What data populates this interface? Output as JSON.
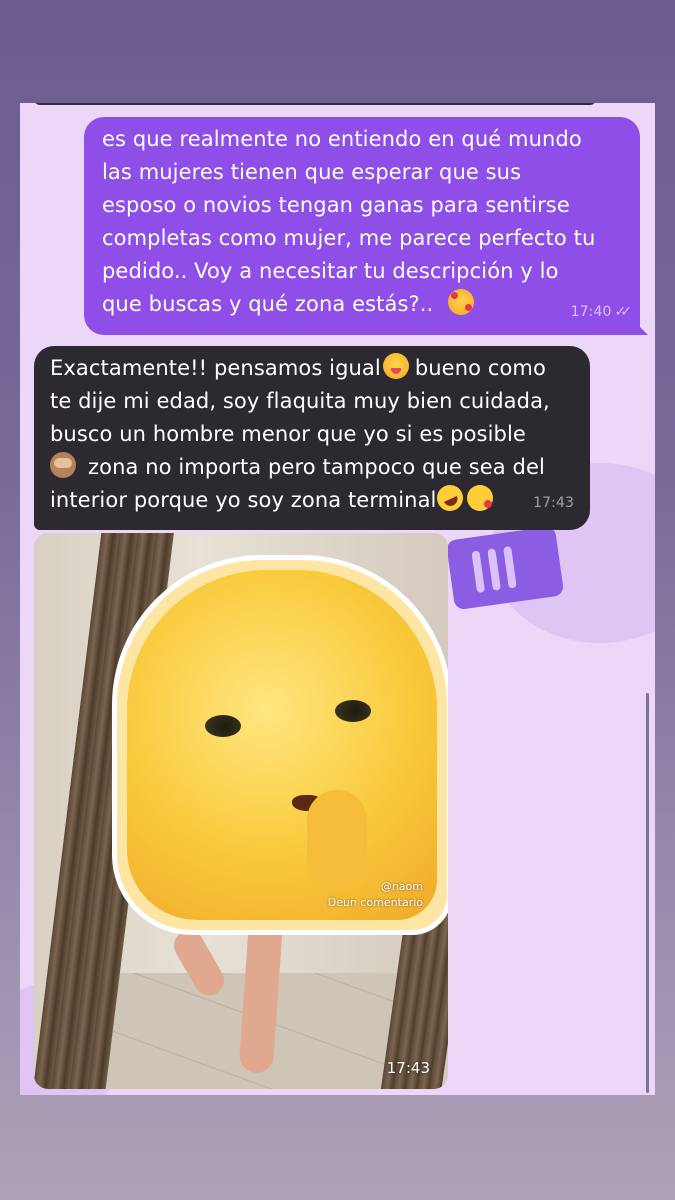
{
  "theme": {
    "outgoing_color": "#8e4ee7",
    "incoming_color": "#2c2930",
    "chat_background": "#ecd7f8"
  },
  "messages": [
    {
      "direction": "outgoing",
      "lines": [
        "es que realmente no entiendo en qué mundo",
        "las mujeres tienen que esperar que sus",
        "esposo o novios tengan ganas para sentirse",
        "completas como mujer, me parece perfecto tu",
        "pedido.. Voy a necesitar tu descripción y lo",
        "que buscas y qué zona estás?.."
      ],
      "emoji": "smiling-face-with-hearts",
      "time": "17:40",
      "status": "read-double-check"
    },
    {
      "direction": "incoming",
      "lines": [
        "Exactamente!! pensamos igual",
        "bueno como",
        "te dije mi edad, soy flaquita muy bien cuidada,",
        "busco un hombre menor que yo si es posible",
        "zona no importa pero tampoco que sea del",
        "interior porque yo soy zona terminal"
      ],
      "emojis": [
        "face-savoring-food",
        "see-no-evil-monkey",
        "rolling-on-floor-laughing",
        "face-blowing-kiss"
      ],
      "time": "17:43"
    },
    {
      "direction": "incoming",
      "type": "photo",
      "sticker_credit": [
        "@naom",
        "Deun comentario"
      ],
      "time": "17:43"
    }
  ]
}
